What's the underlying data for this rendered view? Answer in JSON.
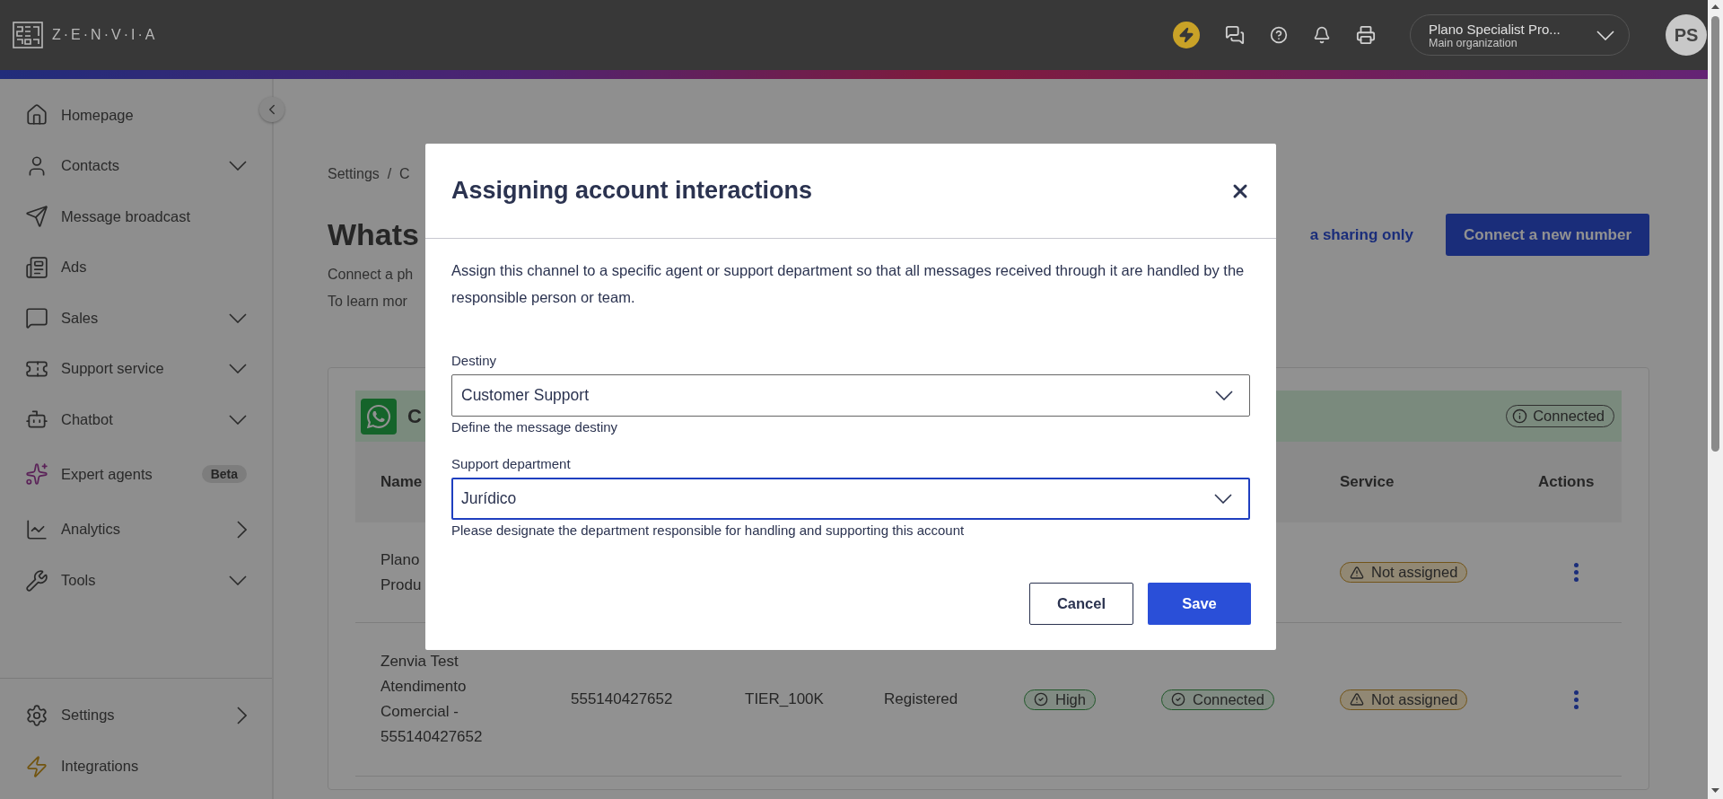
{
  "topbar": {
    "logo_text": "Z·E·N·V·I·A",
    "organization": {
      "name": "Plano Specialist Pro...",
      "subtitle": "Main organization"
    },
    "avatar": "PS"
  },
  "sidebar": {
    "items": [
      {
        "label": "Homepage",
        "kind": "link"
      },
      {
        "label": "Contacts",
        "kind": "group"
      },
      {
        "label": "Message broadcast",
        "kind": "link"
      },
      {
        "label": "Ads",
        "kind": "link"
      },
      {
        "label": "Sales",
        "kind": "group"
      },
      {
        "label": "Support service",
        "kind": "group"
      },
      {
        "label": "Chatbot",
        "kind": "group"
      },
      {
        "label": "Expert agents",
        "kind": "link",
        "badge": "Beta"
      },
      {
        "label": "Analytics",
        "kind": "submenu"
      },
      {
        "label": "Tools",
        "kind": "group"
      }
    ],
    "bottom_items": [
      {
        "label": "Settings",
        "kind": "submenu"
      },
      {
        "label": "Integrations",
        "kind": "link"
      }
    ]
  },
  "page": {
    "breadcrumb": "Settings  /  C",
    "title": "Whats",
    "description": [
      "Connect a ph",
      "To learn mor"
    ],
    "link": "a sharing only",
    "primary_button": "Connect a new number"
  },
  "card": {
    "title": "C",
    "status": "Connected",
    "table": {
      "columns": [
        {
          "label": "Name"
        },
        {
          "label": "Service"
        },
        {
          "label": "Actions"
        }
      ],
      "rows": [
        {
          "cells": [
            {
              "kind": "lines",
              "lines": [
                "Plano",
                "Produ"
              ]
            },
            {
              "kind": "warning",
              "text": "Not assigned"
            },
            {
              "kind": "actions"
            }
          ]
        },
        {
          "cells": [
            {
              "kind": "lines",
              "lines": [
                "Zenvia Test",
                "Atendimento",
                "Comercial -",
                "555140427652"
              ]
            },
            {
              "kind": "text",
              "text": "555140427652"
            },
            {
              "kind": "text",
              "text": "TIER_100K"
            },
            {
              "kind": "text",
              "text": "Registered"
            },
            {
              "kind": "success",
              "text": "High"
            },
            {
              "kind": "success",
              "text": "Connected"
            },
            {
              "kind": "warning",
              "text": "Not assigned"
            },
            {
              "kind": "actions"
            }
          ]
        }
      ]
    }
  },
  "modal": {
    "title": "Assigning account interactions",
    "description": "Assign this channel to a specific agent or support department so that all messages received through it are handled by the responsible person or team.",
    "fields": [
      {
        "label": "Destiny",
        "value": "Customer Support",
        "helper": "Define the message destiny",
        "focused": false
      },
      {
        "label": "Support department",
        "value": "Jurídico",
        "helper": "Please designate the department responsible for handling and supporting this account",
        "focused": true
      }
    ],
    "buttons": [
      {
        "label": "Cancel",
        "kind": "secondary"
      },
      {
        "label": "Save",
        "kind": "primary"
      }
    ]
  }
}
